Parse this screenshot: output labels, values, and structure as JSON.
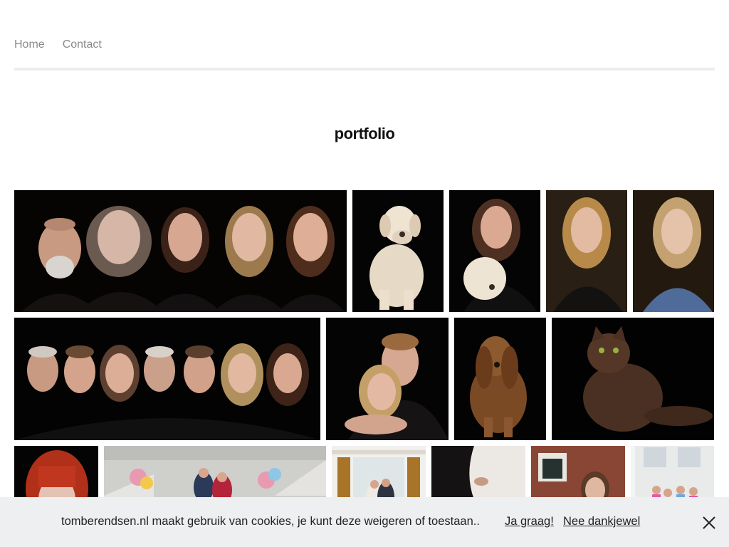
{
  "nav": {
    "items": [
      {
        "label": "Home"
      },
      {
        "label": "Contact"
      }
    ]
  },
  "page": {
    "title": "portfolio"
  },
  "gallery": {
    "photos": [
      {
        "subject": "family-portrait-five-people"
      },
      {
        "subject": "white-labrador-sitting"
      },
      {
        "subject": "woman-with-labrador"
      },
      {
        "subject": "blonde-woman-portrait"
      },
      {
        "subject": "blonde-woman-blue-sweater"
      },
      {
        "subject": "family-portrait-seven-people"
      },
      {
        "subject": "couple-embracing"
      },
      {
        "subject": "brown-dog-sitting"
      },
      {
        "subject": "long-haired-cat"
      },
      {
        "subject": "red-haired-woman"
      },
      {
        "subject": "wedding-ceremony-flowers"
      },
      {
        "subject": "wedding-couple-window"
      },
      {
        "subject": "wedding-dress-detail"
      },
      {
        "subject": "bride-brick-building"
      },
      {
        "subject": "group-bright-room"
      }
    ]
  },
  "cookie": {
    "message": "tomberendsen.nl maakt gebruik van cookies, je kunt deze weigeren of toestaan..",
    "accept_label": "Ja graag!",
    "decline_label": "Nee dankjewel",
    "close_icon": "close-icon"
  },
  "colors": {
    "nav_text": "#8a8a8a",
    "cookie_bar": "#eeeff0",
    "photo_background": "#000000"
  }
}
